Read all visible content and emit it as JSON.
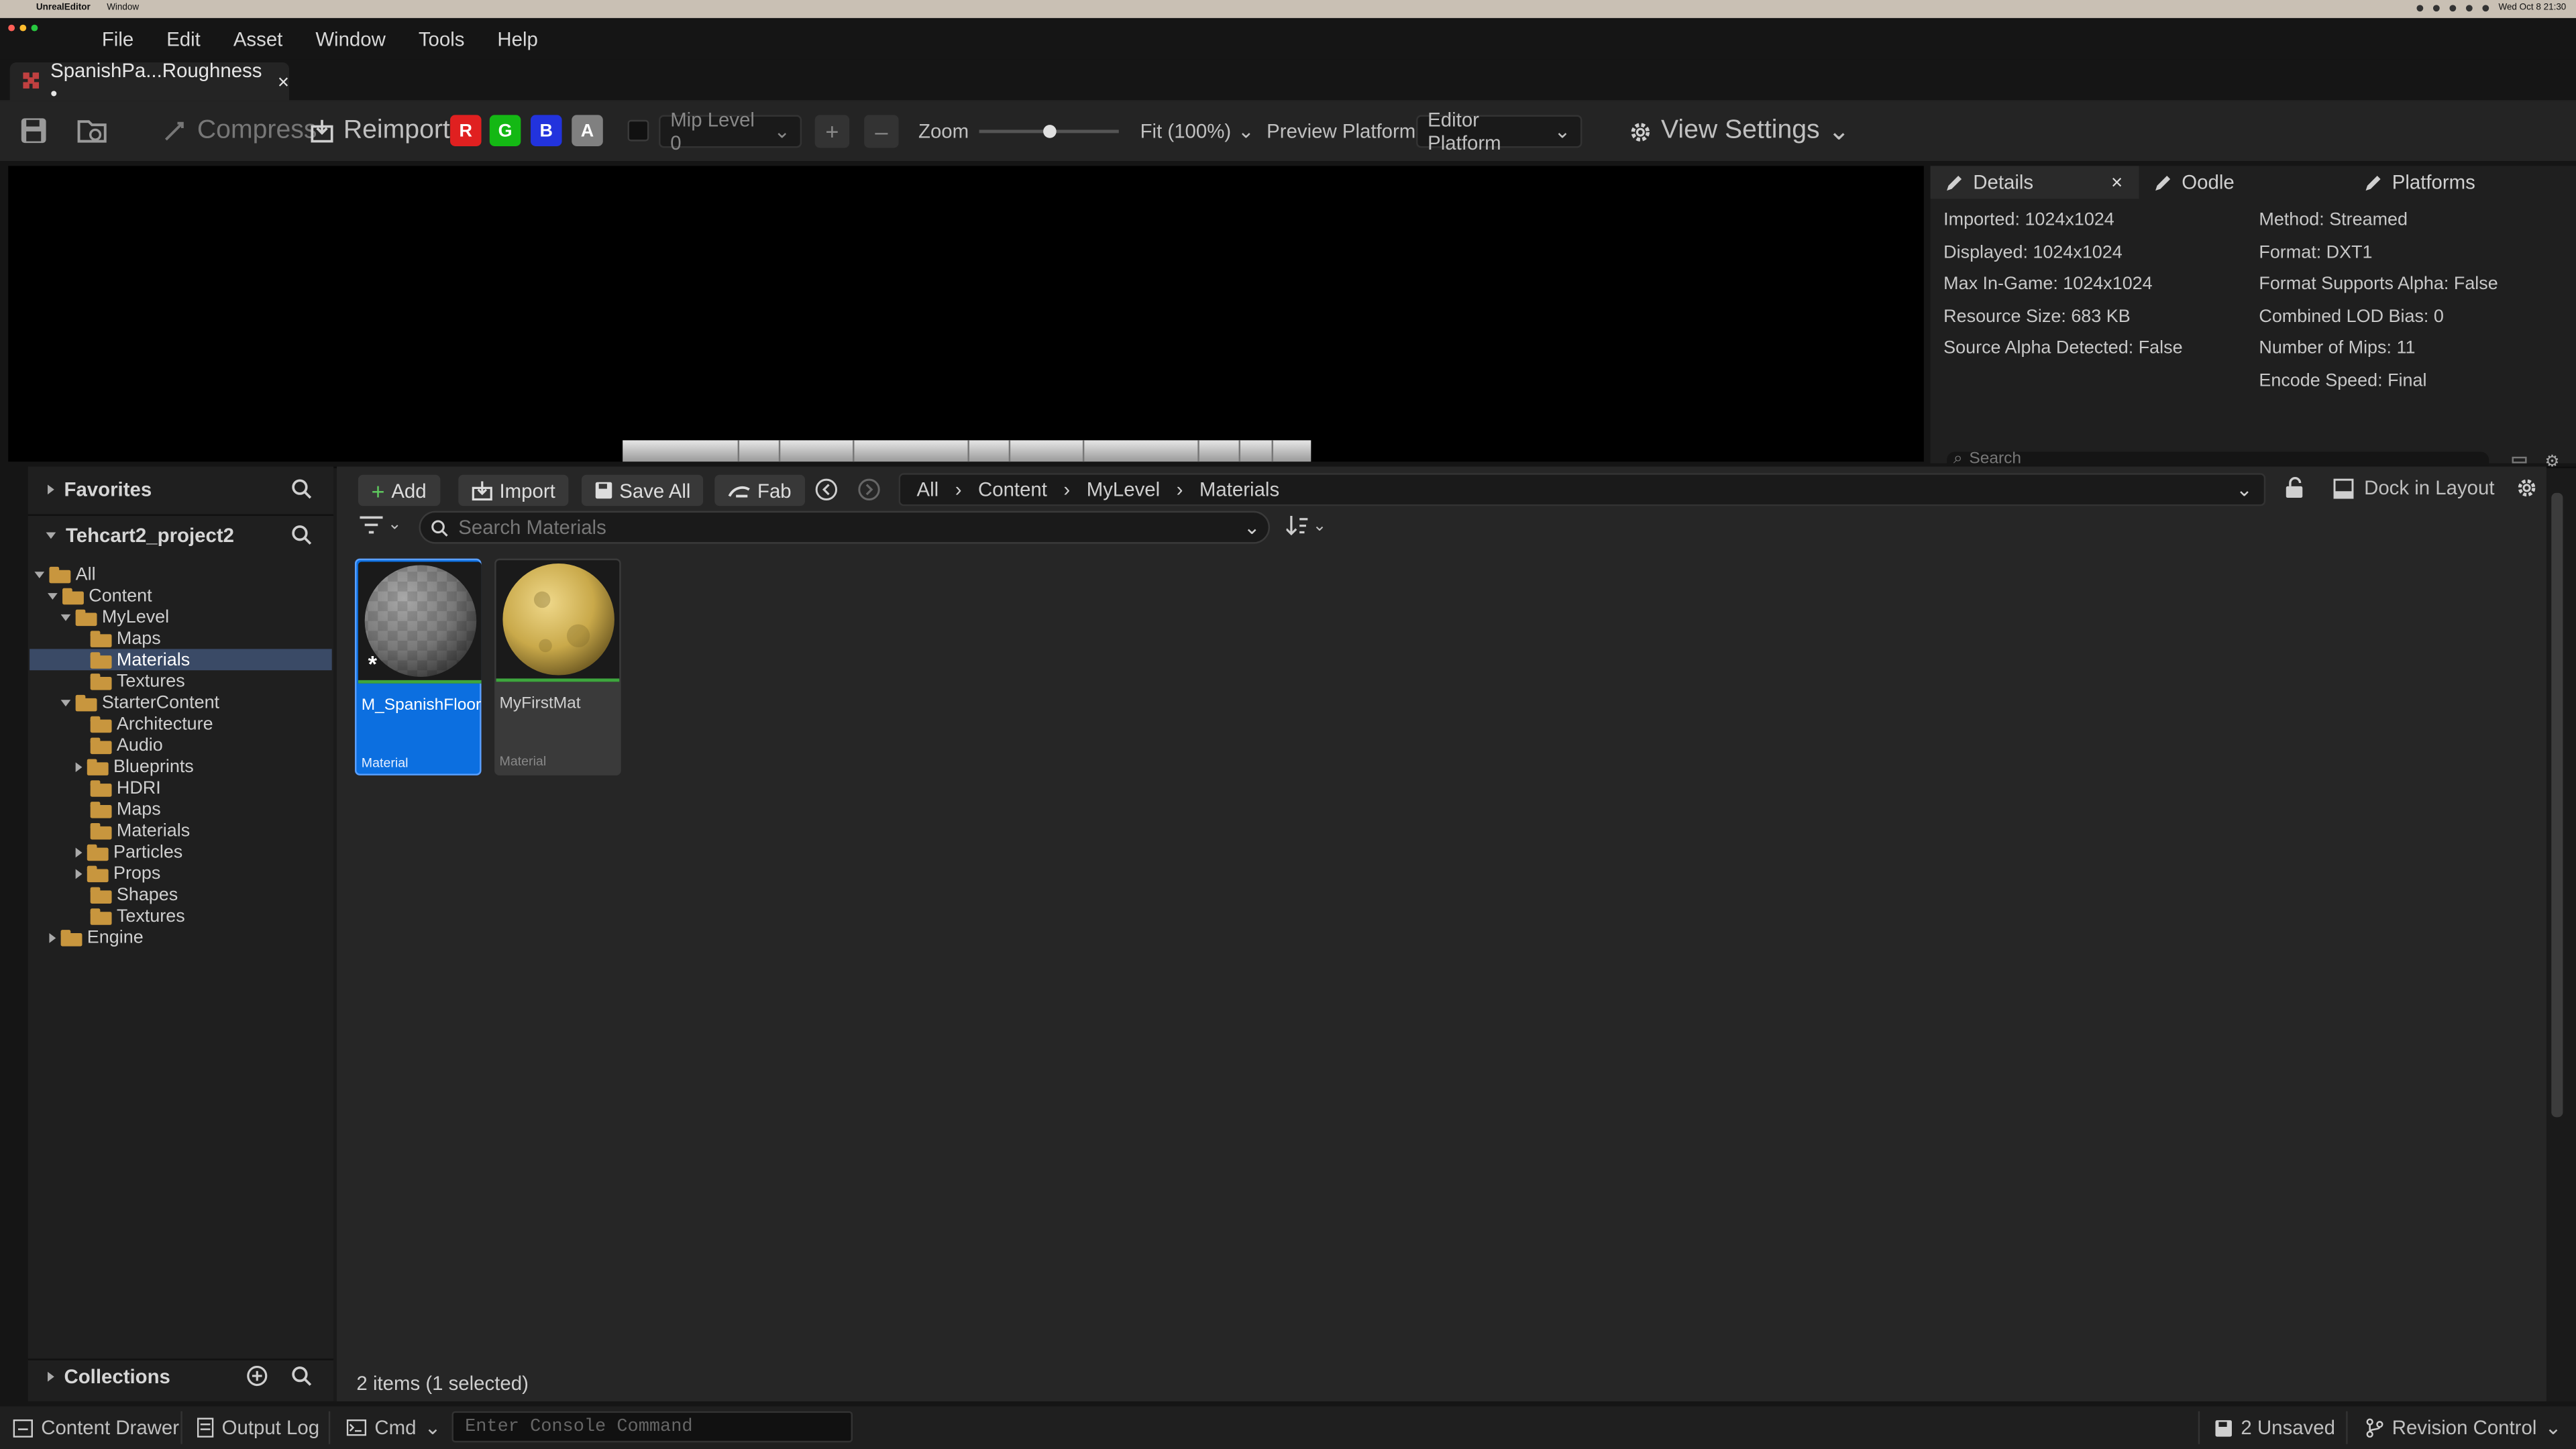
{
  "macbar": {
    "app": "UnrealEditor",
    "menu1": "Window",
    "clock": "Wed Oct 8 21:30"
  },
  "menu": [
    "File",
    "Edit",
    "Asset",
    "Window",
    "Tools",
    "Help"
  ],
  "tab": {
    "title": "SpanishPa...Roughness •",
    "close": "×"
  },
  "toolbar": {
    "compress": "Compress",
    "reimport": "Reimport",
    "channels": [
      {
        "label": "R",
        "color": "#e02020"
      },
      {
        "label": "G",
        "color": "#14b814"
      },
      {
        "label": "B",
        "color": "#2233dd"
      },
      {
        "label": "A",
        "color": "#808080"
      }
    ],
    "mip_level": "Mip Level 0",
    "zoom_label": "Zoom",
    "zoom_value": 0.5,
    "fit": "Fit (100%)",
    "preview_platform_label": "Preview Platform:",
    "preview_platform": "Editor Platform",
    "view_settings": "View Settings"
  },
  "details_tabs": [
    "Details",
    "Oodle",
    "Platforms"
  ],
  "details_close": "×",
  "details_left": [
    "Imported: 1024x1024",
    "Displayed: 1024x1024",
    "Max In-Game: 1024x1024",
    "Resource Size: 683 KB",
    "Source Alpha Detected: False"
  ],
  "details_right": [
    "Method: Streamed",
    "Format: DXT1",
    "Format Supports Alpha: False",
    "Combined LOD Bias: 0",
    "Number of Mips: 11",
    "Encode Speed: Final"
  ],
  "details_search": "Search",
  "tree": {
    "favorites": "Favorites",
    "project": "Tehcart2_project2",
    "collections": "Collections",
    "nodes": [
      "All",
      "Content",
      "MyLevel",
      "Maps",
      "Materials",
      "Textures",
      "StarterContent",
      "Architecture",
      "Audio",
      "Blueprints",
      "HDRI",
      "Maps",
      "Materials",
      "Particles",
      "Props",
      "Shapes",
      "Textures",
      "Engine"
    ]
  },
  "cb": {
    "add": "Add",
    "import": "Import",
    "save_all": "Save All",
    "fab": "Fab",
    "path": [
      "All",
      "Content",
      "MyLevel",
      "Materials"
    ],
    "dock": "Dock in Layout",
    "search_placeholder": "Search Materials",
    "assets": [
      {
        "name": "M_SpanishFloor",
        "type": "Material"
      },
      {
        "name": "MyFirstMat",
        "type": "Material"
      }
    ],
    "status": "2 items (1 selected)"
  },
  "bottom": {
    "content_drawer": "Content Drawer",
    "output_log": "Output Log",
    "cmd": "Cmd",
    "console_placeholder": "Enter Console Command",
    "unsaved": "2 Unsaved",
    "revision": "Revision Control"
  }
}
